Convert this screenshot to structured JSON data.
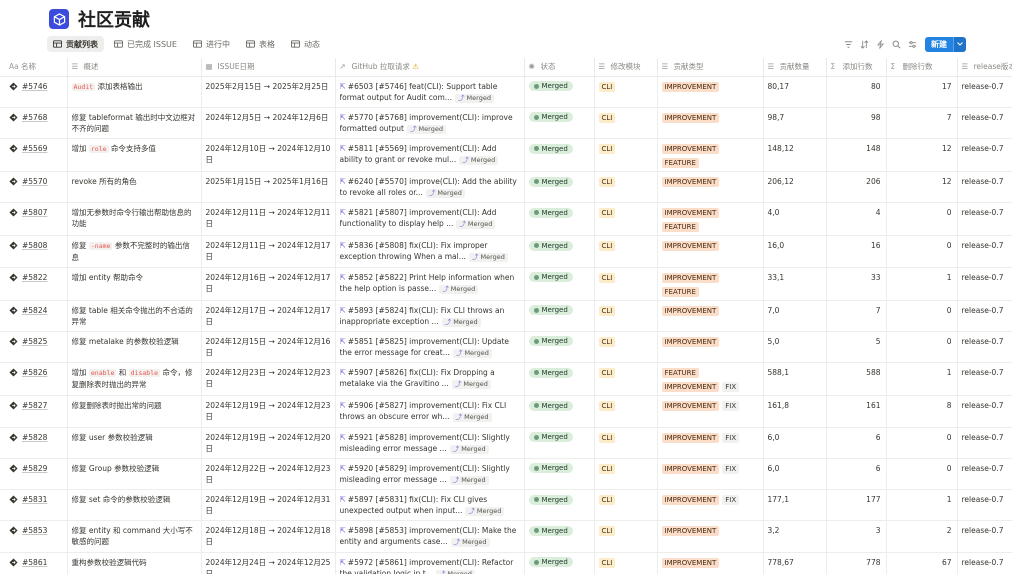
{
  "page": {
    "title": "社区贡献",
    "logo_icon": "cube-logo-icon",
    "accent": "#2383e2"
  },
  "views": [
    {
      "label": "贡献列表",
      "active": true
    },
    {
      "label": "已完成 ISSUE",
      "active": false
    },
    {
      "label": "进行中",
      "active": false
    },
    {
      "label": "表格",
      "active": false
    },
    {
      "label": "动态",
      "active": false
    }
  ],
  "toolbar": {
    "new_label": "新建"
  },
  "columns": {
    "name": "名称",
    "name_icon": "Aa",
    "desc": "概述",
    "date": "ISSUE日期",
    "pr": "GitHub 拉取请求",
    "pr_warn": "⚠",
    "status": "状态",
    "module": "修改模块",
    "type": "贡献类型",
    "count": "贡献数量",
    "add": "添加行数",
    "add_icon": "Σ",
    "del": "删除行数",
    "del_icon": "Σ",
    "release": "release版本"
  },
  "rows": [
    {
      "name": "#5746",
      "desc": [
        {
          "c": "Audit"
        },
        {
          "t": " 添加表格输出"
        }
      ],
      "date": "2025年2月15日 → 2025年2月25日",
      "pr": "#6503 [#5746] feat(CLI): Support table format output for Audit com...",
      "badge": "Merged",
      "status": "Merged",
      "module": "CLI",
      "types": [
        "IMPROVEMENT"
      ],
      "count": "80,17",
      "add": "80",
      "del": "17",
      "release": "release-0.7"
    },
    {
      "name": "#5768",
      "desc": [
        {
          "t": "修复 tableformat 输出时中文边框对不齐的问题"
        }
      ],
      "date": "2024年12月5日 → 2024年12月6日",
      "pr": "#5770 [#5768] improvement(CLI): improve formatted output",
      "badge": "Merged",
      "status": "Merged",
      "module": "CLI",
      "types": [
        "IMPROVEMENT"
      ],
      "count": "98,7",
      "add": "98",
      "del": "7",
      "release": "release-0.7"
    },
    {
      "name": "#5569",
      "desc": [
        {
          "t": "增加 "
        },
        {
          "c": "role"
        },
        {
          "t": " 命令支持多值"
        }
      ],
      "date": "2024年12月10日 → 2024年12月10日",
      "pr": "#5811 [#5569] improvement(CLI): Add ability to grant or revoke mul...",
      "badge": "Merged",
      "status": "Merged",
      "module": "CLI",
      "types": [
        "IMPROVEMENT",
        "FEATURE"
      ],
      "count": "148,12",
      "add": "148",
      "del": "12",
      "release": "release-0.7"
    },
    {
      "name": "#5570",
      "desc": [
        {
          "t": "revoke 所有的角色"
        }
      ],
      "date": "2025年1月15日 → 2025年1月16日",
      "pr": "#6240 [#5570] improve(CLI): Add the ability to revoke all roles or...",
      "badge": "Merged",
      "status": "Merged",
      "module": "CLI",
      "types": [
        "IMPROVEMENT"
      ],
      "count": "206,12",
      "add": "206",
      "del": "12",
      "release": "release-0.7"
    },
    {
      "name": "#5807",
      "desc": [
        {
          "t": "增加无参数时命令行输出帮助信息的功能"
        }
      ],
      "date": "2024年12月11日 → 2024年12月11日",
      "pr": "#5821 [#5807] improvement(CLI): Add functionality to display help ...",
      "badge": "Merged",
      "status": "Merged",
      "module": "CLI",
      "types": [
        "IMPROVEMENT",
        "FEATURE"
      ],
      "count": "4,0",
      "add": "4",
      "del": "0",
      "release": "release-0.7"
    },
    {
      "name": "#5808",
      "desc": [
        {
          "t": "修复 "
        },
        {
          "c": "-name"
        },
        {
          "t": " 参数不完整时的输出信息"
        }
      ],
      "date": "2024年12月11日 → 2024年12月17日",
      "pr": "#5836 [#5808] fix(CLI): Fix improper exception throwing When a mal...",
      "badge": "Merged",
      "status": "Merged",
      "module": "CLI",
      "types": [
        "IMPROVEMENT"
      ],
      "count": "16,0",
      "add": "16",
      "del": "0",
      "release": "release-0.7"
    },
    {
      "name": "#5822",
      "desc": [
        {
          "t": "增加 entity 帮助命令"
        }
      ],
      "date": "2024年12月16日 → 2024年12月17日",
      "pr": "#5852 [#5822] Print Help information when the help option is passe...",
      "badge": "Merged",
      "status": "Merged",
      "module": "CLI",
      "types": [
        "IMPROVEMENT",
        "FEATURE"
      ],
      "count": "33,1",
      "add": "33",
      "del": "1",
      "release": "release-0.7"
    },
    {
      "name": "#5824",
      "desc": [
        {
          "t": "修复 table 相关命令抛出的不合适的异常"
        }
      ],
      "date": "2024年12月17日 → 2024年12月17日",
      "pr": "#5893 [#5824] fix(CLI): Fix CLI throws an inappropriate exception ...",
      "badge": "Merged",
      "status": "Merged",
      "module": "CLI",
      "types": [
        "IMPROVEMENT"
      ],
      "count": "7,0",
      "add": "7",
      "del": "0",
      "release": "release-0.7"
    },
    {
      "name": "#5825",
      "desc": [
        {
          "t": "修复 metalake 的参数校验逻辑"
        }
      ],
      "date": "2024年12月15日 → 2024年12月16日",
      "pr": "#5851 [#5825] improvement(CLI): Update the error message for creat...",
      "badge": "Merged",
      "status": "Merged",
      "module": "CLI",
      "types": [
        "IMPROVEMENT"
      ],
      "count": "5,0",
      "add": "5",
      "del": "0",
      "release": "release-0.7"
    },
    {
      "name": "#5826",
      "desc": [
        {
          "t": "增加 "
        },
        {
          "c": "enable"
        },
        {
          "t": " 和 "
        },
        {
          "c": "disable"
        },
        {
          "t": " 命令，修复删除表时抛出的异常"
        }
      ],
      "date": "2024年12月23日 → 2024年12月23日",
      "pr": "#5907 [#5826] fix(CLI): Fix Dropping a metalake via the Gravitino ...",
      "badge": "Merged",
      "status": "Merged",
      "module": "CLI",
      "types": [
        "FEATURE",
        "IMPROVEMENT",
        "FIX"
      ],
      "count": "588,1",
      "add": "588",
      "del": "1",
      "release": "release-0.7"
    },
    {
      "name": "#5827",
      "desc": [
        {
          "t": "修复删除表时抛出常的问题"
        }
      ],
      "date": "2024年12月19日 → 2024年12月23日",
      "pr": "#5906 [#5827] improvement(CLI): Fix CLI throws an obscure error wh...",
      "badge": "Merged",
      "status": "Merged",
      "module": "CLI",
      "types": [
        "IMPROVEMENT",
        "FIX"
      ],
      "count": "161,8",
      "add": "161",
      "del": "8",
      "release": "release-0.7"
    },
    {
      "name": "#5828",
      "desc": [
        {
          "t": "修复 user 参数校验逻辑"
        }
      ],
      "date": "2024年12月19日 → 2024年12月20日",
      "pr": "#5921 [#5828] improvement(CLI): Slightly misleading error message ...",
      "badge": "Merged",
      "status": "Merged",
      "module": "CLI",
      "types": [
        "IMPROVEMENT",
        "FIX"
      ],
      "count": "6,0",
      "add": "6",
      "del": "0",
      "release": "release-0.7"
    },
    {
      "name": "#5829",
      "desc": [
        {
          "t": "修复 Group 参数校验逻辑"
        }
      ],
      "date": "2024年12月22日 → 2024年12月23日",
      "pr": "#5920 [#5829] improvement(CLI): Slightly misleading error message ...",
      "badge": "Merged",
      "status": "Merged",
      "module": "CLI",
      "types": [
        "IMPROVEMENT",
        "FIX"
      ],
      "count": "6,0",
      "add": "6",
      "del": "0",
      "release": "release-0.7"
    },
    {
      "name": "#5831",
      "desc": [
        {
          "t": "修复 set 命令的参数校验逻辑"
        }
      ],
      "date": "2024年12月19日 → 2024年12月31日",
      "pr": "#5897 [#5831] fix(CLI): Fix CLI gives unexpected output when input...",
      "badge": "Merged",
      "status": "Merged",
      "module": "CLI",
      "types": [
        "IMPROVEMENT",
        "FIX"
      ],
      "count": "177,1",
      "add": "177",
      "del": "1",
      "release": "release-0.7"
    },
    {
      "name": "#5853",
      "desc": [
        {
          "t": "修复 entity 和 command 大小写不敏感的问题"
        }
      ],
      "date": "2024年12月18日 → 2024年12月18日",
      "pr": "#5898 [#5853] improvement(CLI): Make the entity and arguments case...",
      "badge": "Merged",
      "status": "Merged",
      "module": "CLI",
      "types": [
        "IMPROVEMENT"
      ],
      "count": "3,2",
      "add": "3",
      "del": "2",
      "release": "release-0.7"
    },
    {
      "name": "#5861",
      "desc": [
        {
          "t": "重构参数校验逻辑代码"
        }
      ],
      "date": "2024年12月24日 → 2024年12月25日",
      "pr": "#5972 [#5861] improvement(CLI): Refactor the validation logic in t...",
      "badge": "Merged",
      "status": "Merged",
      "module": "CLI",
      "types": [
        "IMPROVEMENT"
      ],
      "count": "778,67",
      "add": "778",
      "del": "67",
      "release": "release-0.7"
    }
  ]
}
